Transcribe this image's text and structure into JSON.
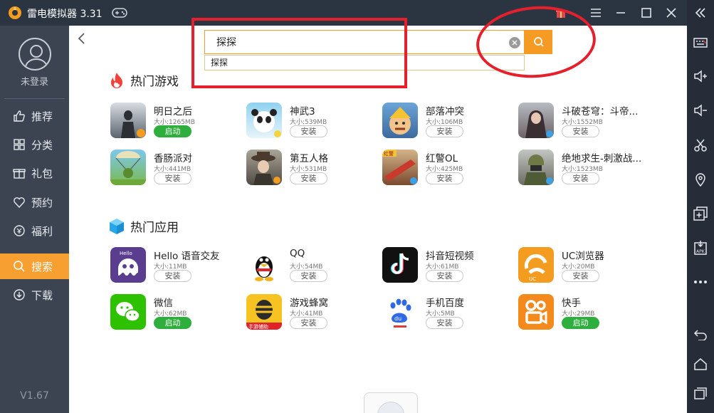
{
  "window": {
    "title": "雷电模拟器 3.31"
  },
  "sidebar": {
    "login": "未登录",
    "items": [
      {
        "label": "推荐",
        "icon": "thumbs-up-icon"
      },
      {
        "label": "分类",
        "icon": "grid-icon"
      },
      {
        "label": "礼包",
        "icon": "gift-icon"
      },
      {
        "label": "预约",
        "icon": "heart-icon"
      },
      {
        "label": "福利",
        "icon": "coin-icon"
      },
      {
        "label": "搜索",
        "icon": "search-icon",
        "active": true
      },
      {
        "label": "下载",
        "icon": "download-icon"
      }
    ],
    "version": "V1.67"
  },
  "search": {
    "value": "探探",
    "suggestion": "探探"
  },
  "sections": {
    "games": {
      "title": "热门游戏",
      "apps": [
        {
          "name": "明日之后",
          "size": "大小:1265MB",
          "action": "启动",
          "launch": true
        },
        {
          "name": "神武3",
          "size": "大小:539MB",
          "action": "安装",
          "launch": false
        },
        {
          "name": "部落冲突",
          "size": "大小:106MB",
          "action": "安装",
          "launch": false
        },
        {
          "name": "斗破苍穹：斗帝...",
          "size": "大小:1552MB",
          "action": "安装",
          "launch": false
        },
        {
          "name": "香肠派对",
          "size": "大小:441MB",
          "action": "安装",
          "launch": false
        },
        {
          "name": "第五人格",
          "size": "大小:531MB",
          "action": "安装",
          "launch": false
        },
        {
          "name": "红警OL",
          "size": "大小:425MB",
          "action": "安装",
          "launch": false
        },
        {
          "name": "绝地求生-刺激战...",
          "size": "大小:1523MB",
          "action": "安装",
          "launch": false
        }
      ]
    },
    "apps": {
      "title": "热门应用",
      "apps": [
        {
          "name": "Hello 语音交友",
          "size": "大小:11MB",
          "action": "安装",
          "launch": false
        },
        {
          "name": "QQ",
          "size": "大小:54MB",
          "action": "安装",
          "launch": false
        },
        {
          "name": "抖音短视频",
          "size": "大小:61MB",
          "action": "安装",
          "launch": false
        },
        {
          "name": "UC浏览器",
          "size": "大小:20MB",
          "action": "安装",
          "launch": false
        },
        {
          "name": "微信",
          "size": "大小:62MB",
          "action": "启动",
          "launch": true
        },
        {
          "name": "游戏蜂窝",
          "size": "大小:41MB",
          "action": "安装",
          "launch": false
        },
        {
          "name": "手机百度",
          "size": "大小:5MB",
          "action": "安装",
          "launch": false
        },
        {
          "name": "快手",
          "size": "大小:29MB",
          "action": "启动",
          "launch": true
        }
      ]
    }
  },
  "icon_tiles": {
    "hello": "Hello",
    "uc": "UC",
    "fengwo": "手游辅助",
    "baidu": "du",
    "hongjing": "红警"
  },
  "colors": {
    "accent": "#f59a23",
    "launch": "#2eae3d",
    "sidebar": "#3c4451",
    "titlebar": "#2b3441"
  }
}
